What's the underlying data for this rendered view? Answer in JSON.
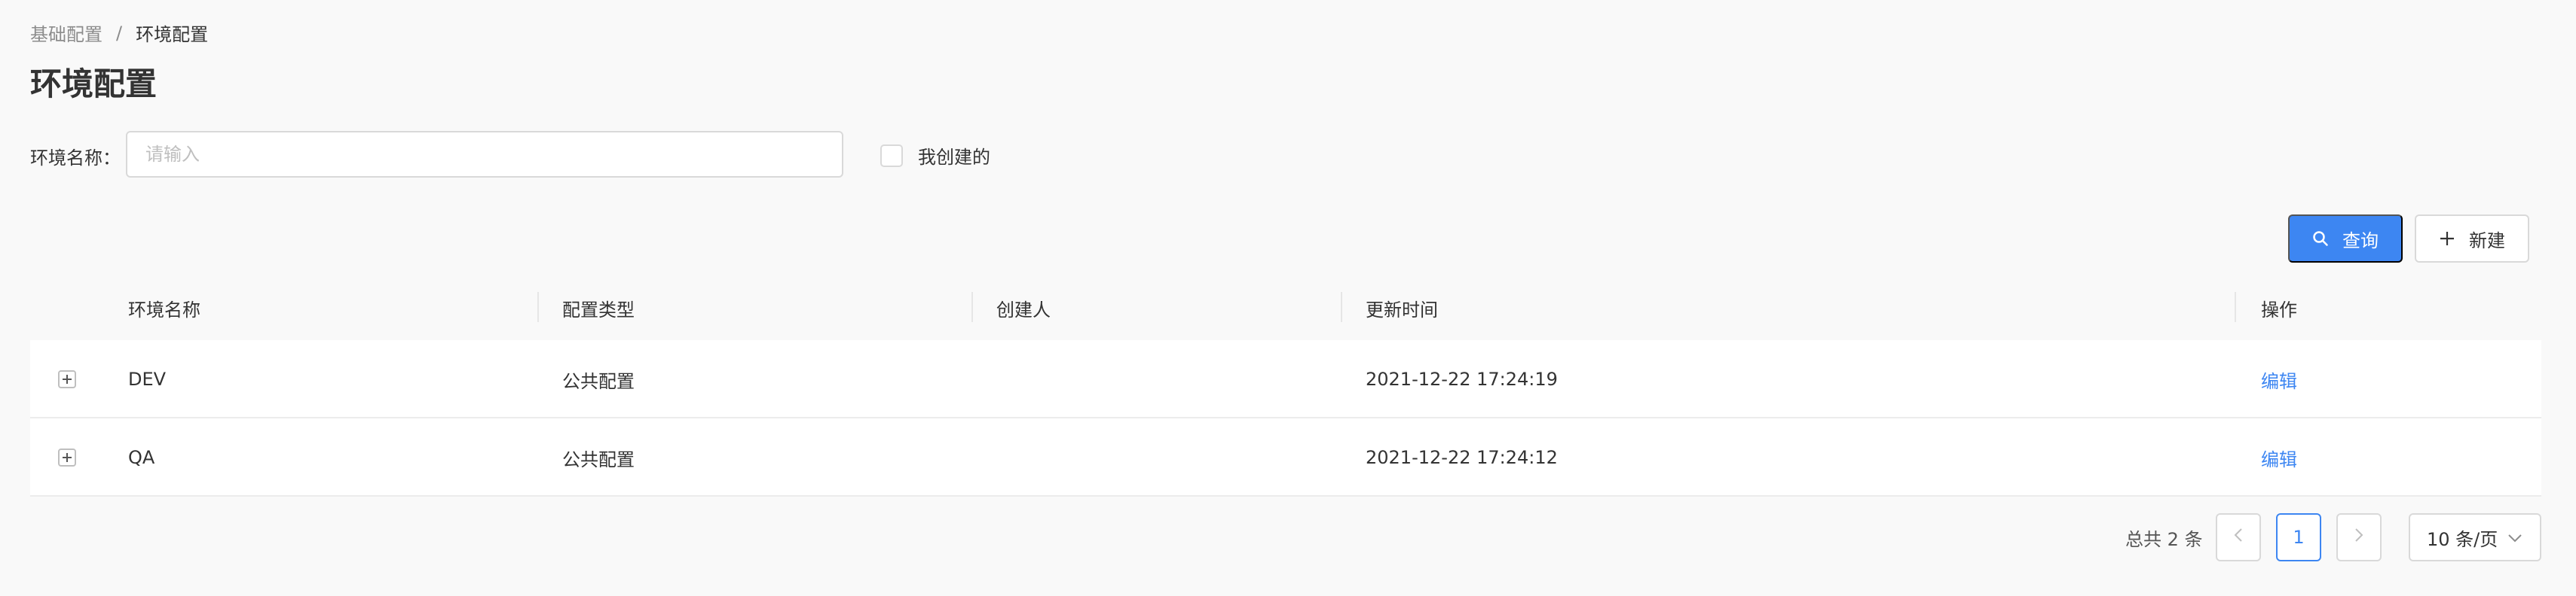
{
  "breadcrumb": {
    "items": [
      "基础配置",
      "环境配置"
    ],
    "separator": "/"
  },
  "page": {
    "title": "环境配置"
  },
  "filters": {
    "env_name_label": "环境名称：",
    "env_name_placeholder": "请输入",
    "created_by_me_label": "我创建的",
    "created_by_me_checked": false
  },
  "toolbar": {
    "query_label": "查询",
    "new_label": "新建",
    "query_icon": "search-icon",
    "new_icon": "plus-icon"
  },
  "table": {
    "columns": [
      "环境名称",
      "配置类型",
      "创建人",
      "更新时间",
      "操作"
    ],
    "rows": [
      {
        "name": "DEV",
        "type": "公共配置",
        "creator": "",
        "updated": "2021-12-22 17:24:19",
        "action": "编辑"
      },
      {
        "name": "QA",
        "type": "公共配置",
        "creator": "",
        "updated": "2021-12-22 17:24:12",
        "action": "编辑"
      }
    ]
  },
  "pagination": {
    "total_text": "总共 2 条",
    "current_page": "1",
    "page_size": "10 条/页"
  },
  "colors": {
    "primary": "#3d86f2",
    "background": "#f9f9f9"
  }
}
